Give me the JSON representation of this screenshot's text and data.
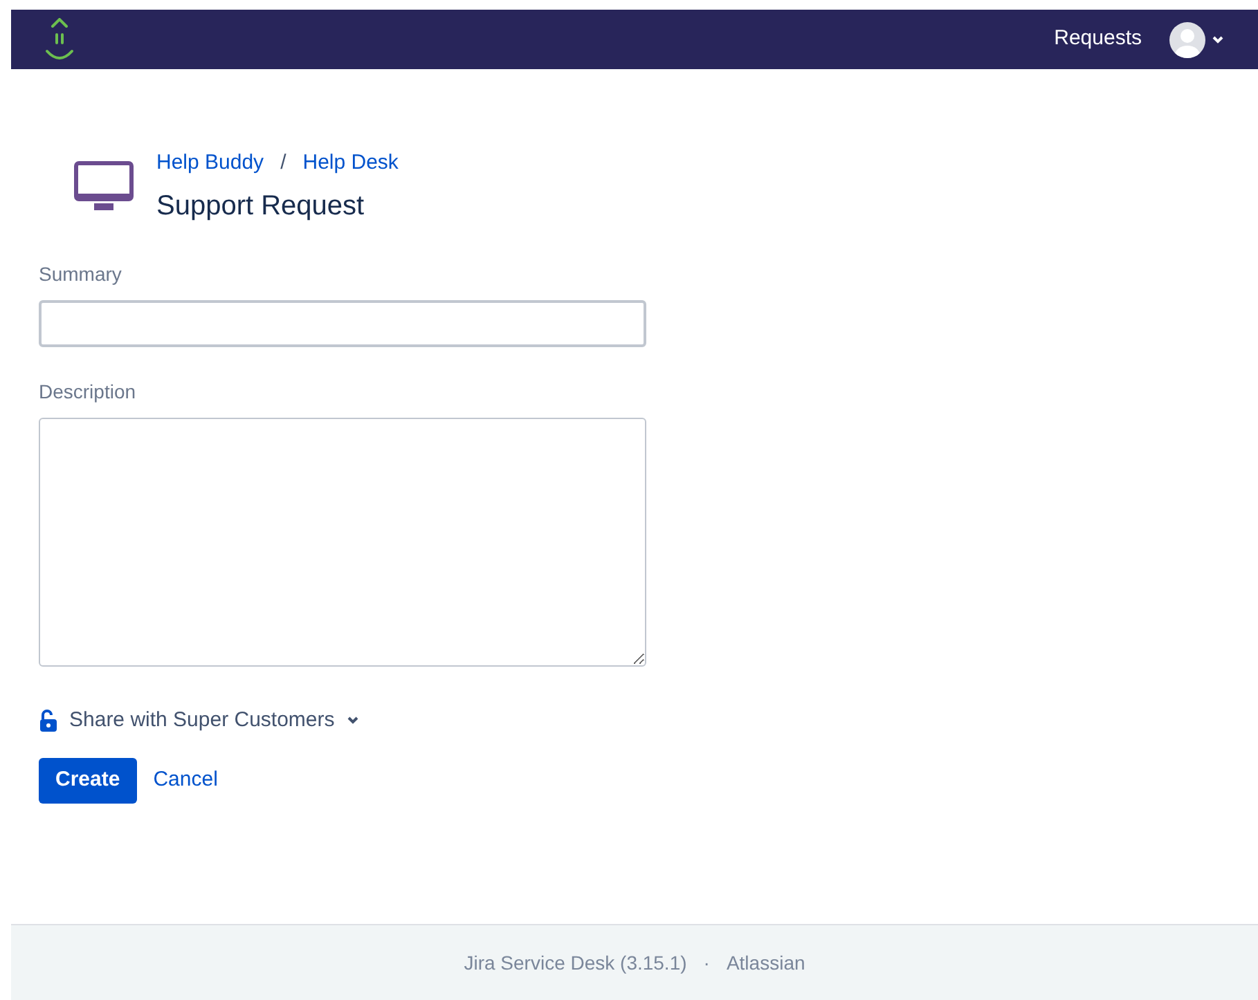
{
  "header": {
    "nav_link": "Requests"
  },
  "breadcrumbs": [
    "Help Buddy",
    "Help Desk"
  ],
  "breadcrumb_separator": "/",
  "page_title": "Support Request",
  "fields": [
    {
      "kind": "input",
      "label": "Summary",
      "focused": true
    },
    {
      "kind": "textarea",
      "label": "Description",
      "focused": false
    }
  ],
  "share": {
    "label": "Share with Super Customers"
  },
  "buttons": {
    "primary": "Create",
    "secondary": "Cancel"
  },
  "footer": {
    "product": "Jira Service Desk (3.15.1)",
    "separator": "·",
    "company": "Atlassian"
  }
}
